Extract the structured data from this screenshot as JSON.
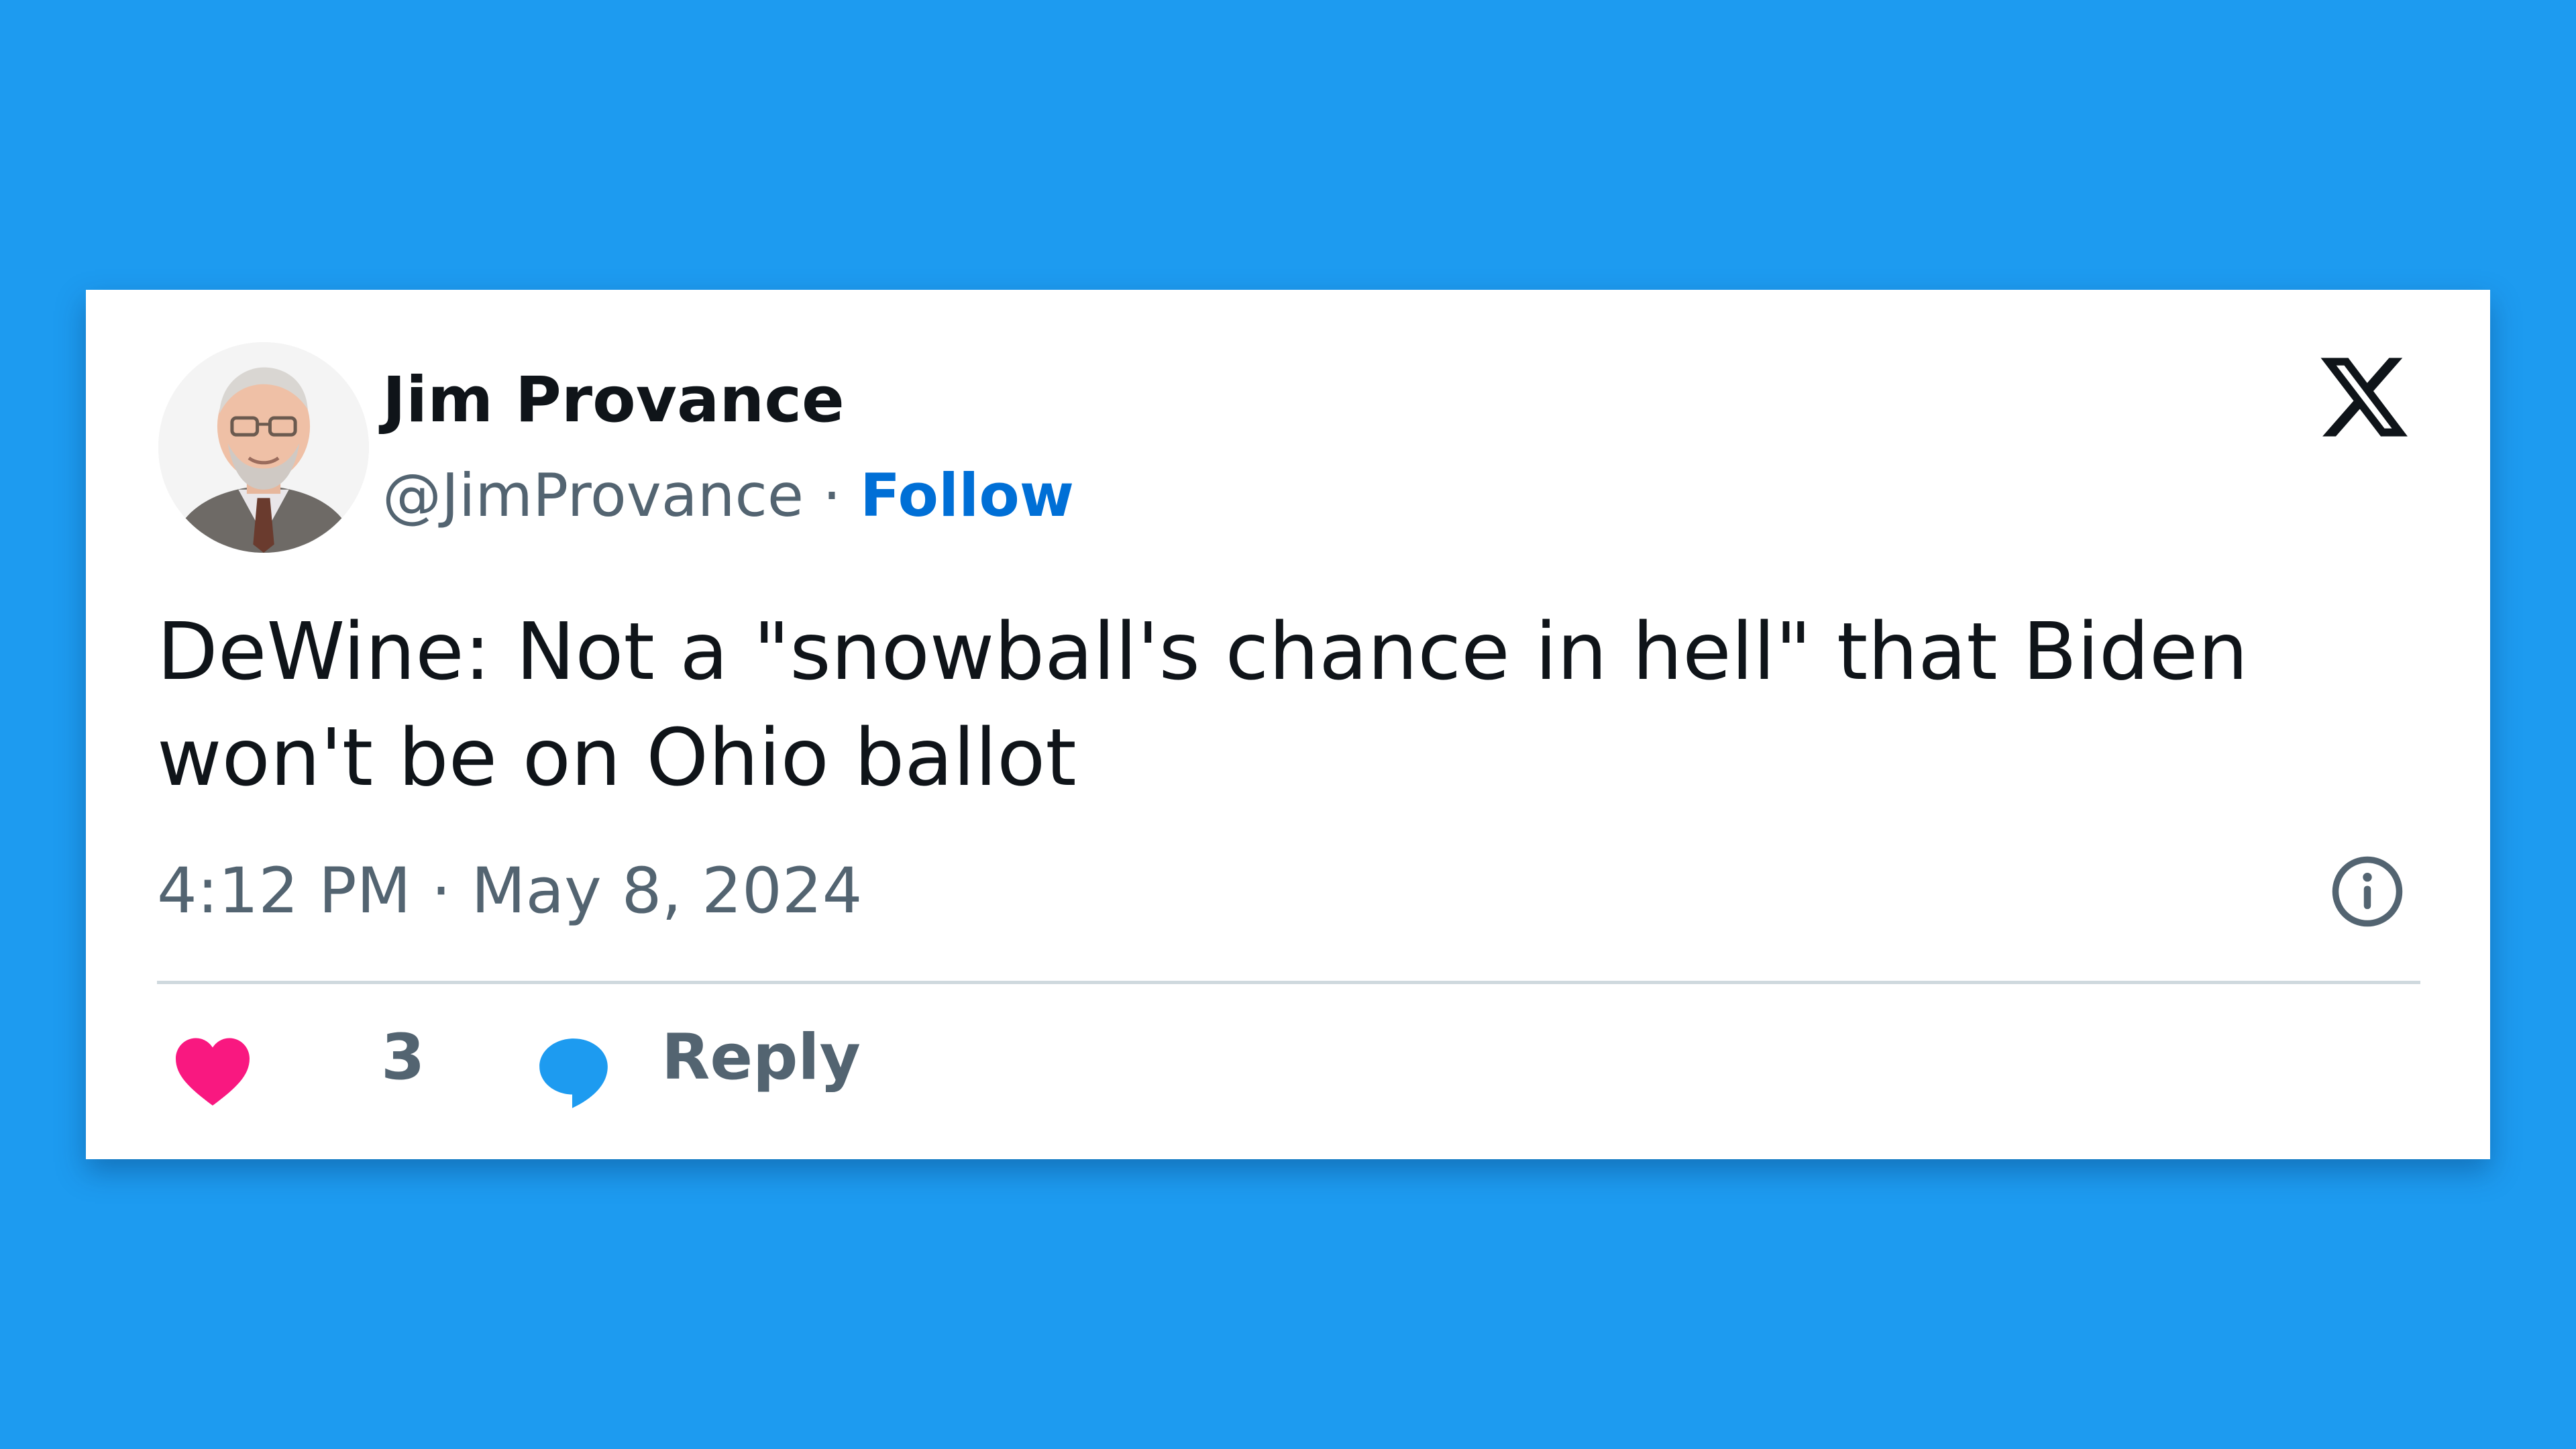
{
  "colors": {
    "background": "#1d9bf0",
    "card": "#ffffff",
    "follow_link": "#006fd6",
    "heart": "#f91880",
    "reply_bubble": "#1d9bf0",
    "muted_text": "#536471"
  },
  "author": {
    "display_name": "Jim Provance",
    "handle": "@JimProvance",
    "separator": "·",
    "follow_label": "Follow",
    "avatar_icon": "profile-photo"
  },
  "tweet": {
    "text": "DeWine: Not a \"snowball's chance in hell\" that Biden won't be on Ohio ballot",
    "timestamp": "4:12 PM · May 8, 2024"
  },
  "actions": {
    "like_count": "3",
    "reply_label": "Reply"
  },
  "icons": {
    "brand": "x-logo",
    "info": "info-icon",
    "like": "heart-icon",
    "reply": "speech-bubble-icon"
  }
}
